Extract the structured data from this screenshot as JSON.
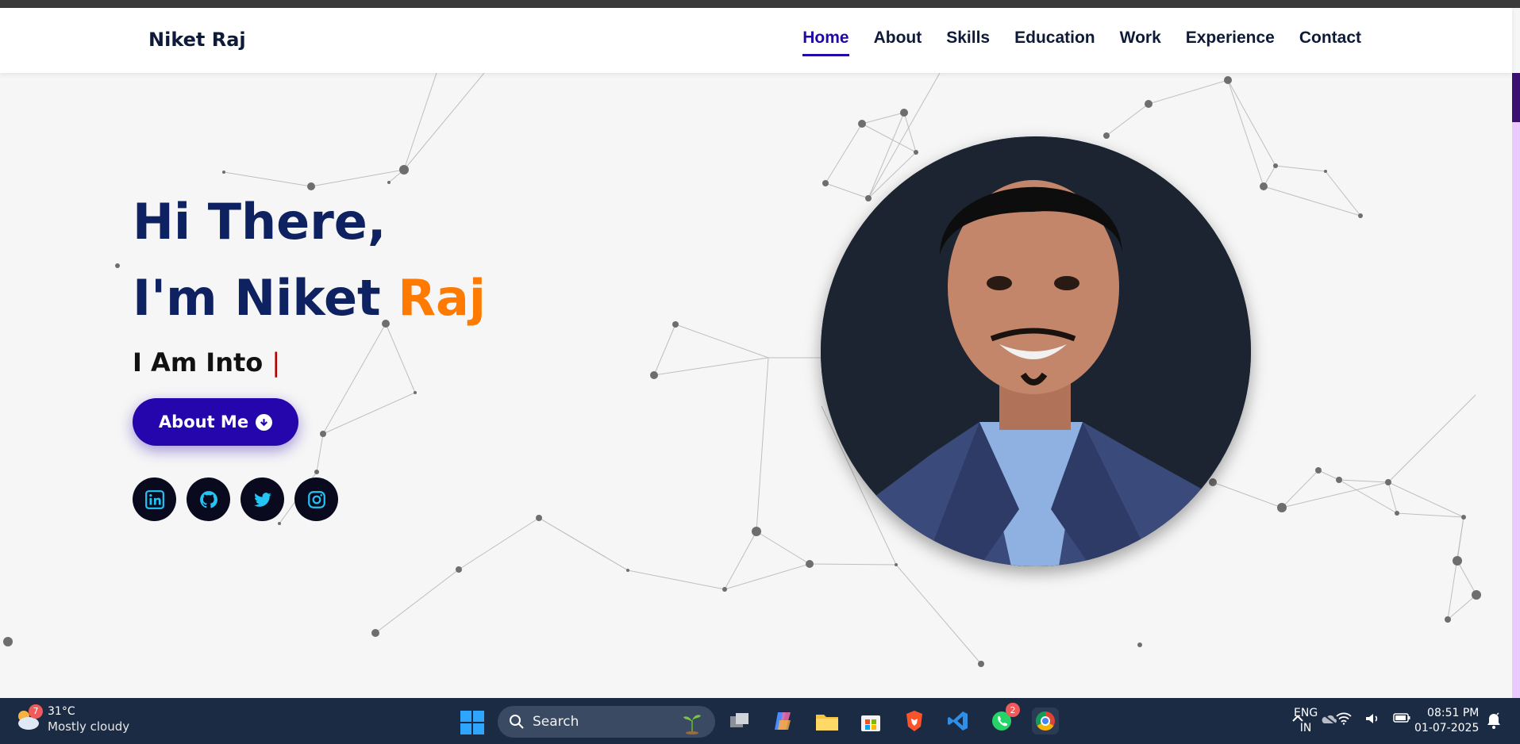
{
  "brand": "Niket Raj",
  "nav": {
    "items": [
      "Home",
      "About",
      "Skills",
      "Education",
      "Work",
      "Experience",
      "Contact"
    ],
    "active": "Home"
  },
  "hero": {
    "greeting": "Hi There,",
    "intro_prefix": "I'm Niket ",
    "intro_accent": "Raj",
    "into": "I Am Into ",
    "cursor": "|",
    "button_label": "About Me"
  },
  "socials": [
    "linkedin-icon",
    "github-icon",
    "twitter-icon",
    "instagram-icon"
  ],
  "colors": {
    "accent": "#ff7a00",
    "primary": "#2506ad",
    "heading": "#0e2160"
  },
  "taskbar": {
    "weather_badge": "7",
    "temperature": "31°C",
    "weather_desc": "Mostly cloudy",
    "search_label": "Search",
    "whatsapp_badge": "2",
    "lang_line1": "ENG",
    "lang_line2": "IN",
    "time": "08:51 PM",
    "date": "01-07-2025"
  }
}
